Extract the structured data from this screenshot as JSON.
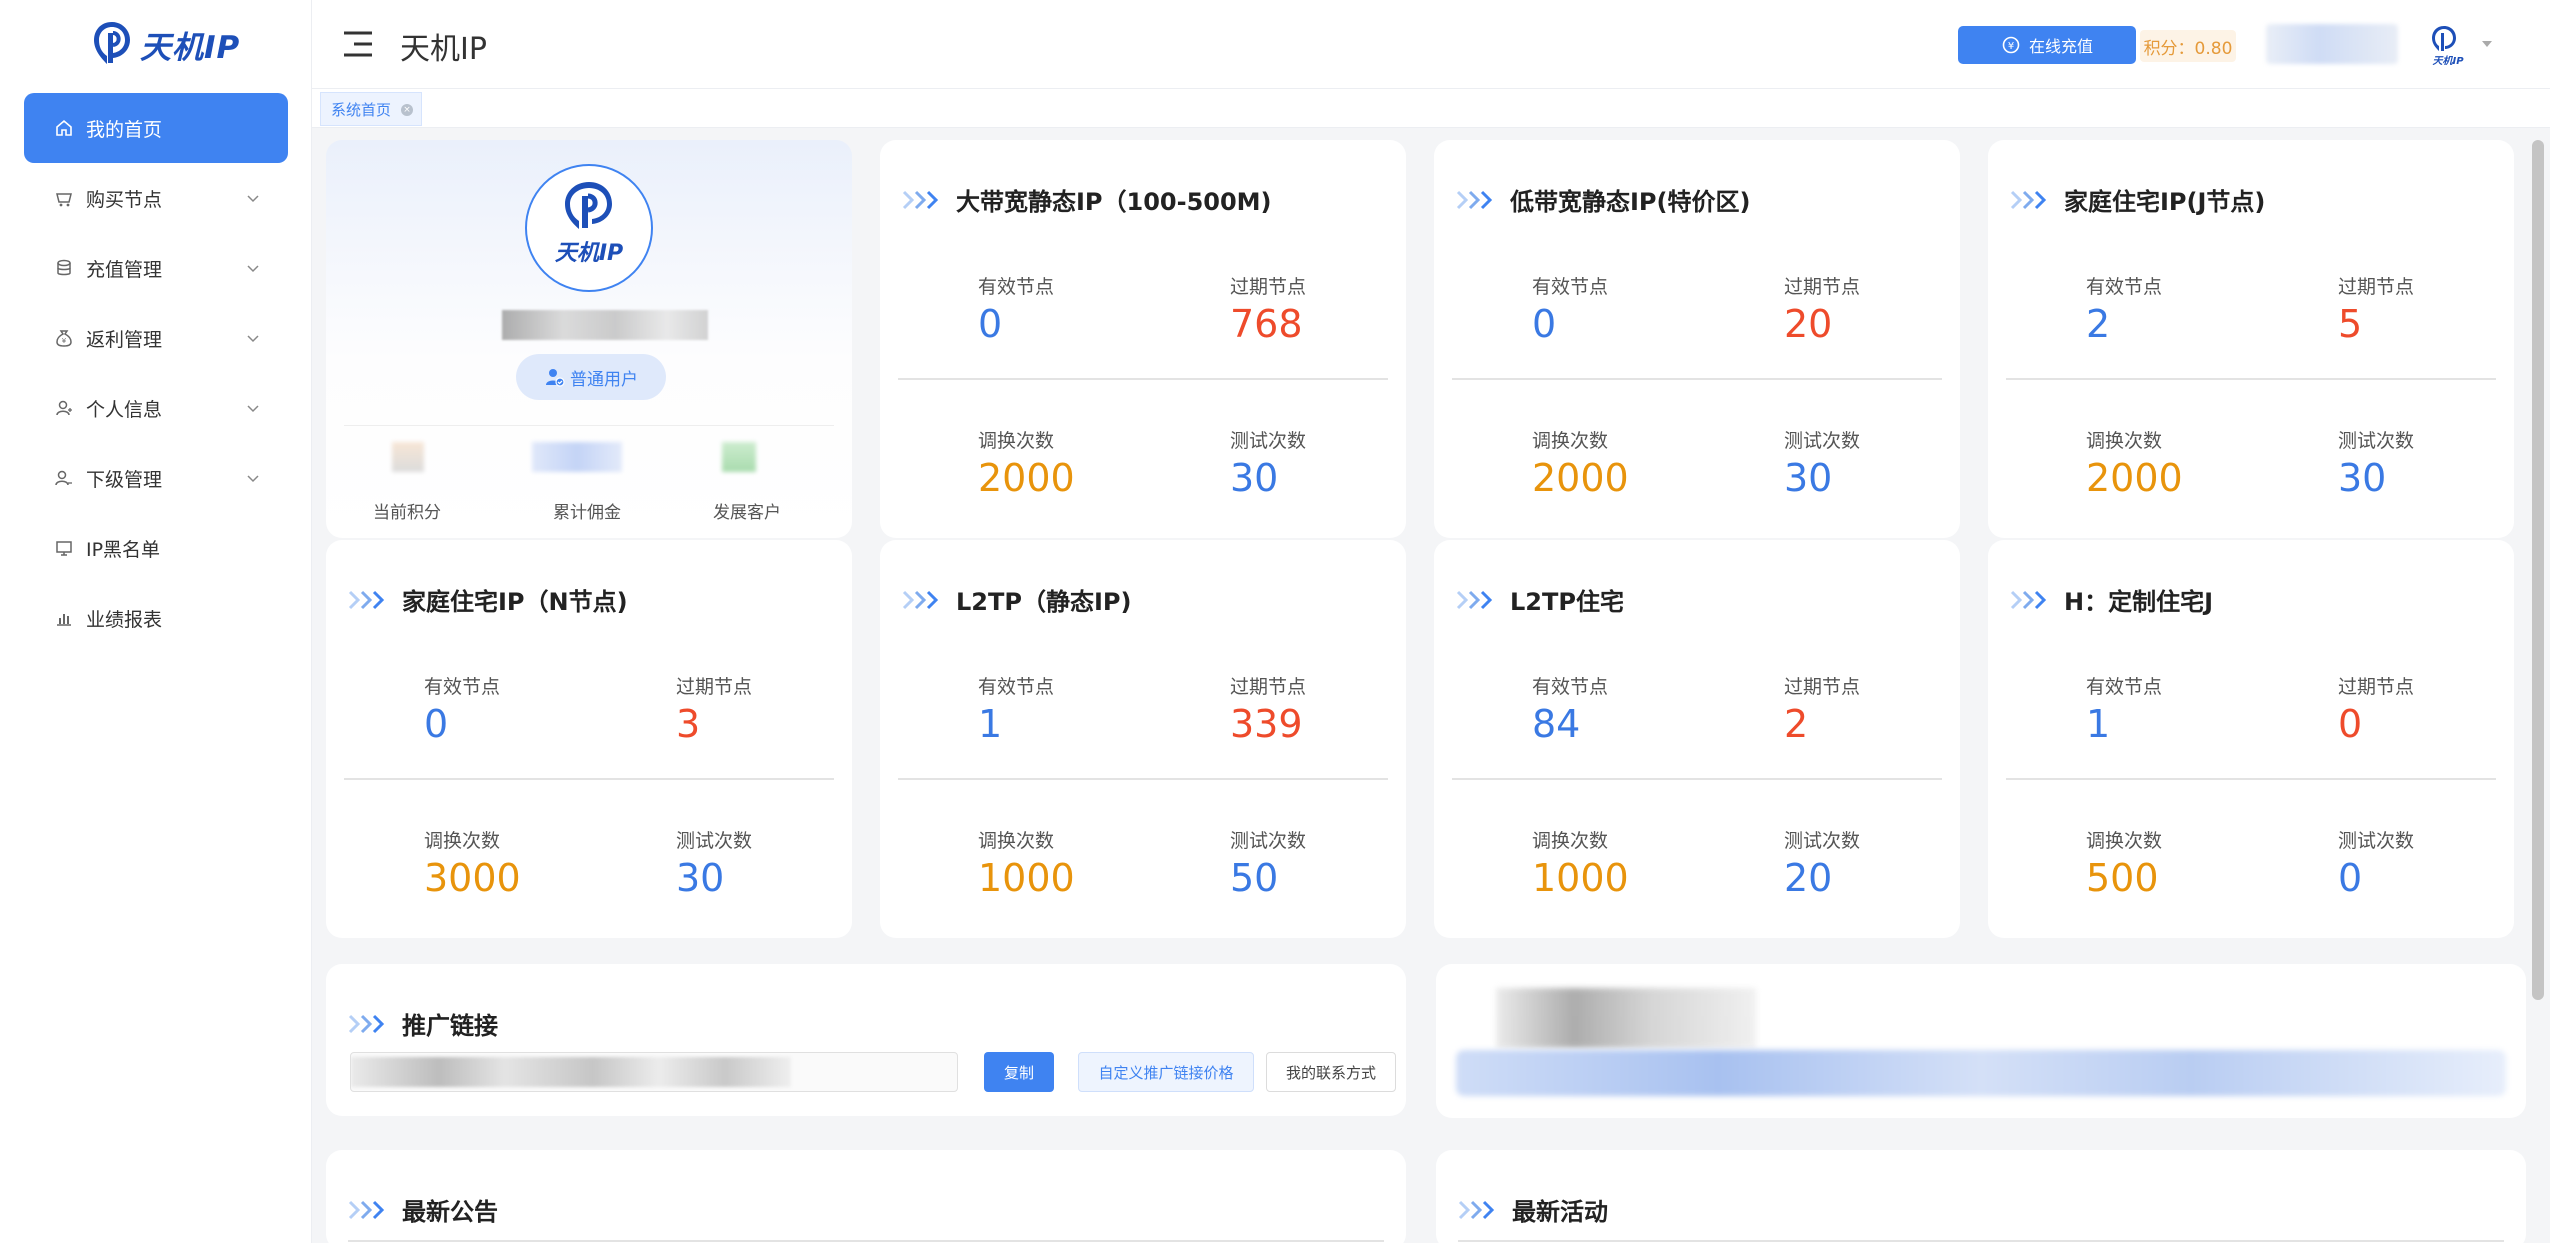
{
  "app": {
    "logo_text": "天机IP",
    "header_title": "天机IP",
    "recharge_label": "在线充值",
    "points_label": "积分：0.80"
  },
  "sidebar": {
    "items": [
      {
        "label": "我的首页",
        "icon": "home-icon",
        "active": true,
        "expandable": false
      },
      {
        "label": "购买节点",
        "icon": "cart-icon",
        "active": false,
        "expandable": true
      },
      {
        "label": "充值管理",
        "icon": "database-icon",
        "active": false,
        "expandable": true
      },
      {
        "label": "返利管理",
        "icon": "money-bag-icon",
        "active": false,
        "expandable": true
      },
      {
        "label": "个人信息",
        "icon": "user-icon",
        "active": false,
        "expandable": true
      },
      {
        "label": "下级管理",
        "icon": "team-icon",
        "active": false,
        "expandable": true
      },
      {
        "label": "IP黑名单",
        "icon": "monitor-icon",
        "active": false,
        "expandable": false
      },
      {
        "label": "业绩报表",
        "icon": "bar-chart-icon",
        "active": false,
        "expandable": false
      }
    ]
  },
  "tabs": [
    {
      "label": "系统首页"
    }
  ],
  "profile": {
    "role": "普通用户",
    "stats": [
      {
        "label": "当前积分"
      },
      {
        "label": "累计佣金"
      },
      {
        "label": "发展客户"
      }
    ]
  },
  "labels": {
    "valid": "有效节点",
    "expired": "过期节点",
    "swap": "调换次数",
    "test": "测试次数"
  },
  "cards": [
    {
      "title": "大带宽静态IP（100-500M)",
      "valid": "0",
      "expired": "768",
      "swap": "2000",
      "test": "30"
    },
    {
      "title": "低带宽静态IP(特价区)",
      "valid": "0",
      "expired": "20",
      "swap": "2000",
      "test": "30"
    },
    {
      "title": "家庭住宅IP(J节点)",
      "valid": "2",
      "expired": "5",
      "swap": "2000",
      "test": "30"
    },
    {
      "title": "家庭住宅IP（N节点)",
      "valid": "0",
      "expired": "3",
      "swap": "3000",
      "test": "30"
    },
    {
      "title": "L2TP（静态IP)",
      "valid": "1",
      "expired": "339",
      "swap": "1000",
      "test": "50"
    },
    {
      "title": "L2TP住宅",
      "valid": "84",
      "expired": "2",
      "swap": "1000",
      "test": "20"
    },
    {
      "title": "H：定制住宅J",
      "valid": "1",
      "expired": "0",
      "swap": "500",
      "test": "0"
    }
  ],
  "promo": {
    "title": "推广链接",
    "copy_label": "复制",
    "custom_label": "自定义推广链接价格",
    "contact_label": "我的联系方式"
  },
  "notice": {
    "title": "最新公告"
  },
  "activity": {
    "title": "最新活动"
  },
  "colors": {
    "primary": "#3f83f1",
    "value_blue": "#3a79e3",
    "value_red": "#ee4b2b",
    "value_orange": "#e8940c",
    "points_text": "#e59a3a"
  }
}
